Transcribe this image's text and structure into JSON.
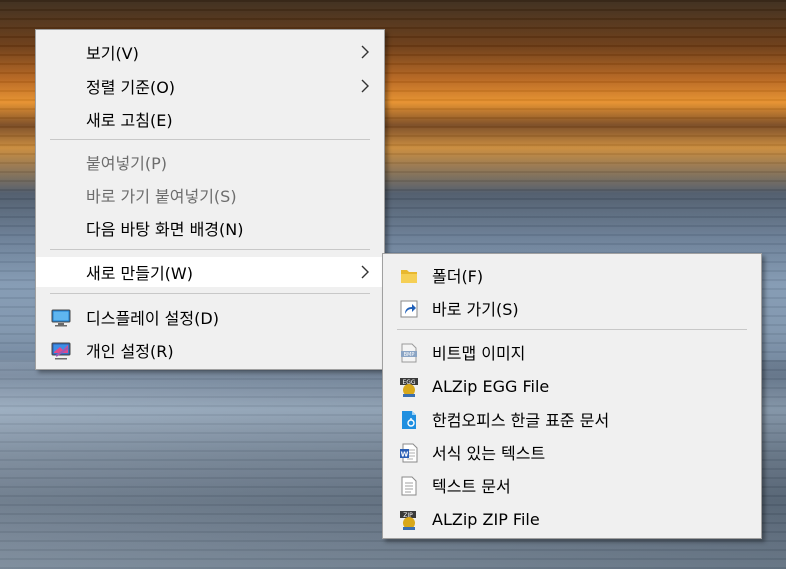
{
  "context_menu": {
    "items": [
      {
        "label": "보기(V)"
      },
      {
        "label": "정렬 기준(O)"
      },
      {
        "label": "새로 고침(E)"
      },
      {
        "label": "붙여넣기(P)"
      },
      {
        "label": "바로 가기 붙여넣기(S)"
      },
      {
        "label": "다음 바탕 화면 배경(N)"
      },
      {
        "label": "새로 만들기(W)"
      },
      {
        "label": "디스플레이 설정(D)"
      },
      {
        "label": "개인 설정(R)"
      }
    ]
  },
  "new_submenu": {
    "items": [
      {
        "label": "폴더(F)",
        "icon": "folder-icon"
      },
      {
        "label": "바로 가기(S)",
        "icon": "shortcut-icon"
      },
      {
        "label": "비트맵 이미지",
        "icon": "bmp-file-icon",
        "badge": "BMP"
      },
      {
        "label": "ALZip EGG File",
        "icon": "egg-file-icon",
        "badge": "EGG"
      },
      {
        "label": "한컴오피스 한글 표준 문서",
        "icon": "hwp-file-icon"
      },
      {
        "label": "서식 있는 텍스트",
        "icon": "rtf-file-icon"
      },
      {
        "label": "텍스트 문서",
        "icon": "text-file-icon"
      },
      {
        "label": "ALZip ZIP File",
        "icon": "zip-file-icon",
        "badge": "ZIP"
      }
    ]
  },
  "colors": {
    "menu_bg": "#f0f0f0",
    "hover_bg": "#ffffff",
    "disabled_text": "#6d6d6d",
    "separator": "#c8c8c8"
  }
}
